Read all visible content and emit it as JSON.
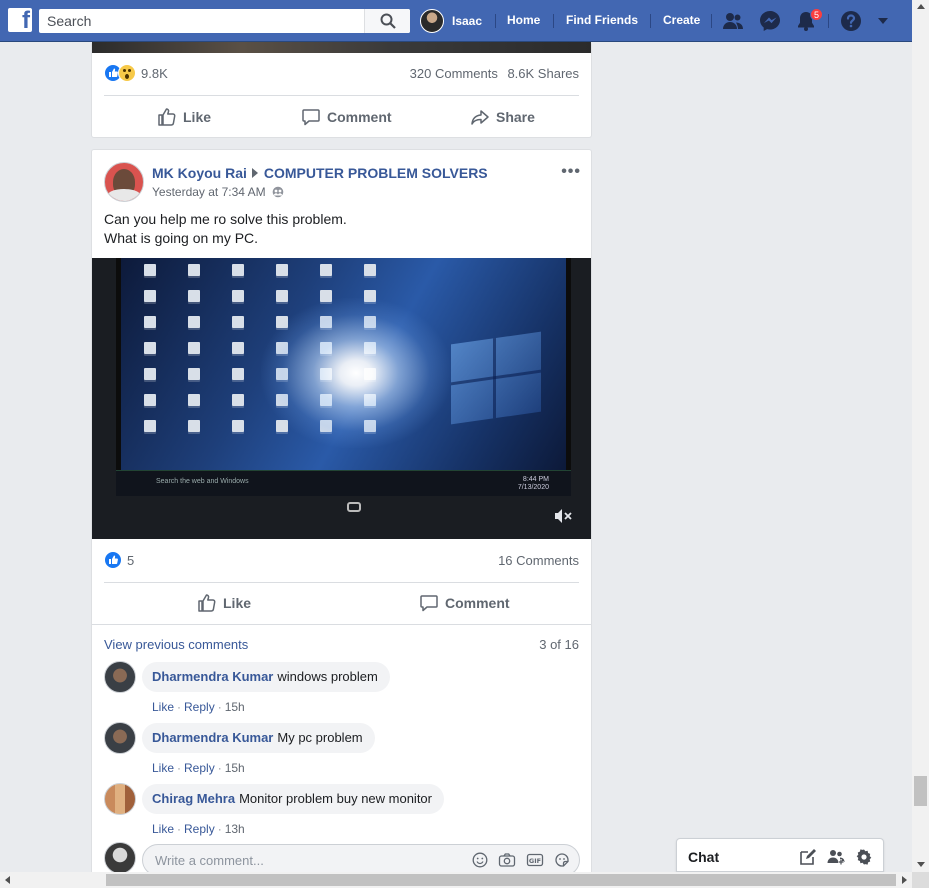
{
  "topbar": {
    "search_placeholder": "Search",
    "profile_name": "Isaac",
    "home": "Home",
    "find_friends": "Find Friends",
    "create": "Create",
    "notification_count": "5",
    "brand_color": "#4267b2"
  },
  "prev_post": {
    "reaction_count": "9.8K",
    "comments": "320 Comments",
    "shares": "8.6K Shares",
    "like_label": "Like",
    "comment_label": "Comment",
    "share_label": "Share"
  },
  "post": {
    "author": "MK Koyou Rai",
    "group": "COMPUTER PROBLEM SOLVERS",
    "time": "Yesterday at 7:34 AM",
    "more": "•••",
    "text_line1": "Can you help me ro solve this problem.",
    "text_line2": "What is going on my PC.",
    "video": {
      "taskbar_search": "Search the web and Windows",
      "clock_time": "8:44 PM",
      "clock_date": "7/13/2020"
    },
    "reaction_count": "5",
    "comments_count": "16 Comments",
    "like_label": "Like",
    "comment_label": "Comment",
    "view_previous": "View previous comments",
    "comment_pager": "3 of 16"
  },
  "comments": [
    {
      "name": "Dharmendra Kumar",
      "text": "windows problem",
      "like": "Like",
      "reply": "Reply",
      "time": "15h"
    },
    {
      "name": "Dharmendra Kumar",
      "text": "My pc problem",
      "like": "Like",
      "reply": "Reply",
      "time": "15h"
    },
    {
      "name": "Chirag Mehra",
      "text": "Monitor problem buy new monitor",
      "like": "Like",
      "reply": "Reply",
      "time": "13h"
    }
  ],
  "write_comment": {
    "placeholder": "Write a comment..."
  },
  "chat": {
    "label": "Chat"
  }
}
